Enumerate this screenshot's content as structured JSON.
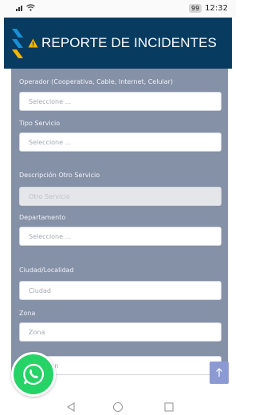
{
  "status_bar": {
    "signal_icon": "signal-icon",
    "wifi_icon": "wifi-icon",
    "battery": "99",
    "time": "12:32"
  },
  "header": {
    "title": "REPORTE DE INCIDENTES",
    "warning_icon": "warning-icon",
    "logo": "stripes-logo",
    "colors": {
      "background": "#083b60",
      "accent_blue": "#1a8fd4",
      "accent_yellow": "#f4b400"
    }
  },
  "form": {
    "background": "#8591a7",
    "fields": [
      {
        "label": "Operador (Cooperativa, Cable, Internet, Celular)",
        "placeholder": "Seleccione ...",
        "type": "select"
      },
      {
        "label": "Tipo Servicio",
        "placeholder": "Seleccione ...",
        "type": "select"
      },
      {
        "label": "Descripción Otro Servicio",
        "placeholder": "Otro Servicio",
        "type": "text-disabled"
      },
      {
        "label": "Departamento",
        "placeholder": "Seleccione ...",
        "type": "select"
      },
      {
        "label": "Ciudad/Localidad",
        "placeholder": "Ciudad",
        "type": "text"
      },
      {
        "label": "Zona",
        "placeholder": "Zona",
        "type": "text"
      },
      {
        "label": "",
        "placeholder": "Dirección",
        "type": "text"
      }
    ]
  },
  "floating": {
    "whatsapp_icon": "whatsapp-icon",
    "scroll_top_icon": "arrow-up-icon"
  },
  "nav": {
    "back": "back-triangle-icon",
    "home": "home-circle-icon",
    "recents": "recents-square-icon"
  }
}
